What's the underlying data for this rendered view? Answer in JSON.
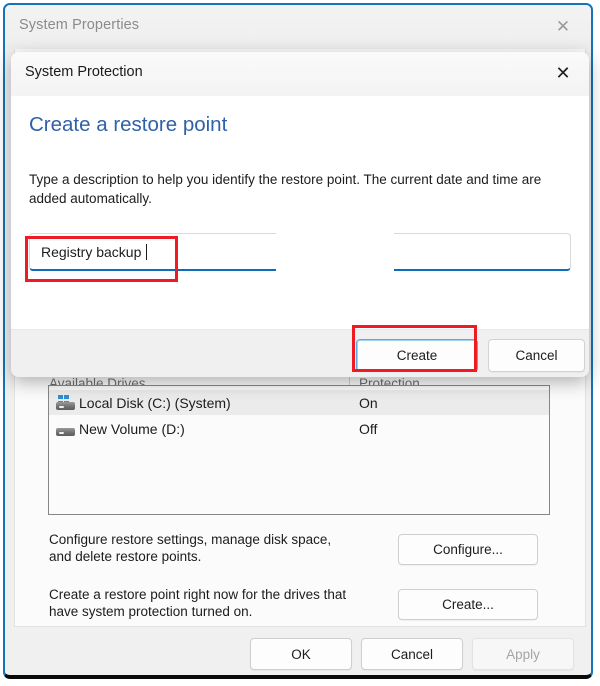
{
  "outer_window": {
    "title": "System Properties",
    "close_icon": "close-icon",
    "close_glyph": "✕"
  },
  "system_protection_tab": {
    "drives": {
      "header_name": "Available Drives",
      "header_protection": "Protection",
      "rows": [
        {
          "name": "Local Disk (C:) (System)",
          "protection": "On",
          "icon": "system-drive-icon",
          "selected": true
        },
        {
          "name": "New Volume (D:)",
          "protection": "Off",
          "icon": "drive-icon",
          "selected": false
        }
      ]
    },
    "configure_section": {
      "description": "Configure restore settings, manage disk space,\nand delete restore points.",
      "button_label": "Configure..."
    },
    "create_section": {
      "description": "Create a restore point right now for the drives that\nhave system protection turned on.",
      "button_label": "Create..."
    },
    "footer_buttons": [
      {
        "label": "OK",
        "disabled": false
      },
      {
        "label": "Cancel",
        "disabled": false
      },
      {
        "label": "Apply",
        "disabled": true
      }
    ]
  },
  "modal": {
    "title": "System Protection",
    "close_icon": "close-icon",
    "close_glyph": "✕",
    "heading": "Create a restore point",
    "description": "Type a description to help you identify the restore point. The current date and time are added automatically.",
    "input": {
      "value": "Registry backup ",
      "placeholder": ""
    },
    "buttons": [
      {
        "label": "Create",
        "focused": true
      },
      {
        "label": "Cancel",
        "focused": false
      }
    ]
  },
  "colors": {
    "accent_blue": "#0f6cbd",
    "heading_blue": "#2f62a8",
    "annotation_red": "#ee1b24",
    "window_border": "#1573b8"
  }
}
